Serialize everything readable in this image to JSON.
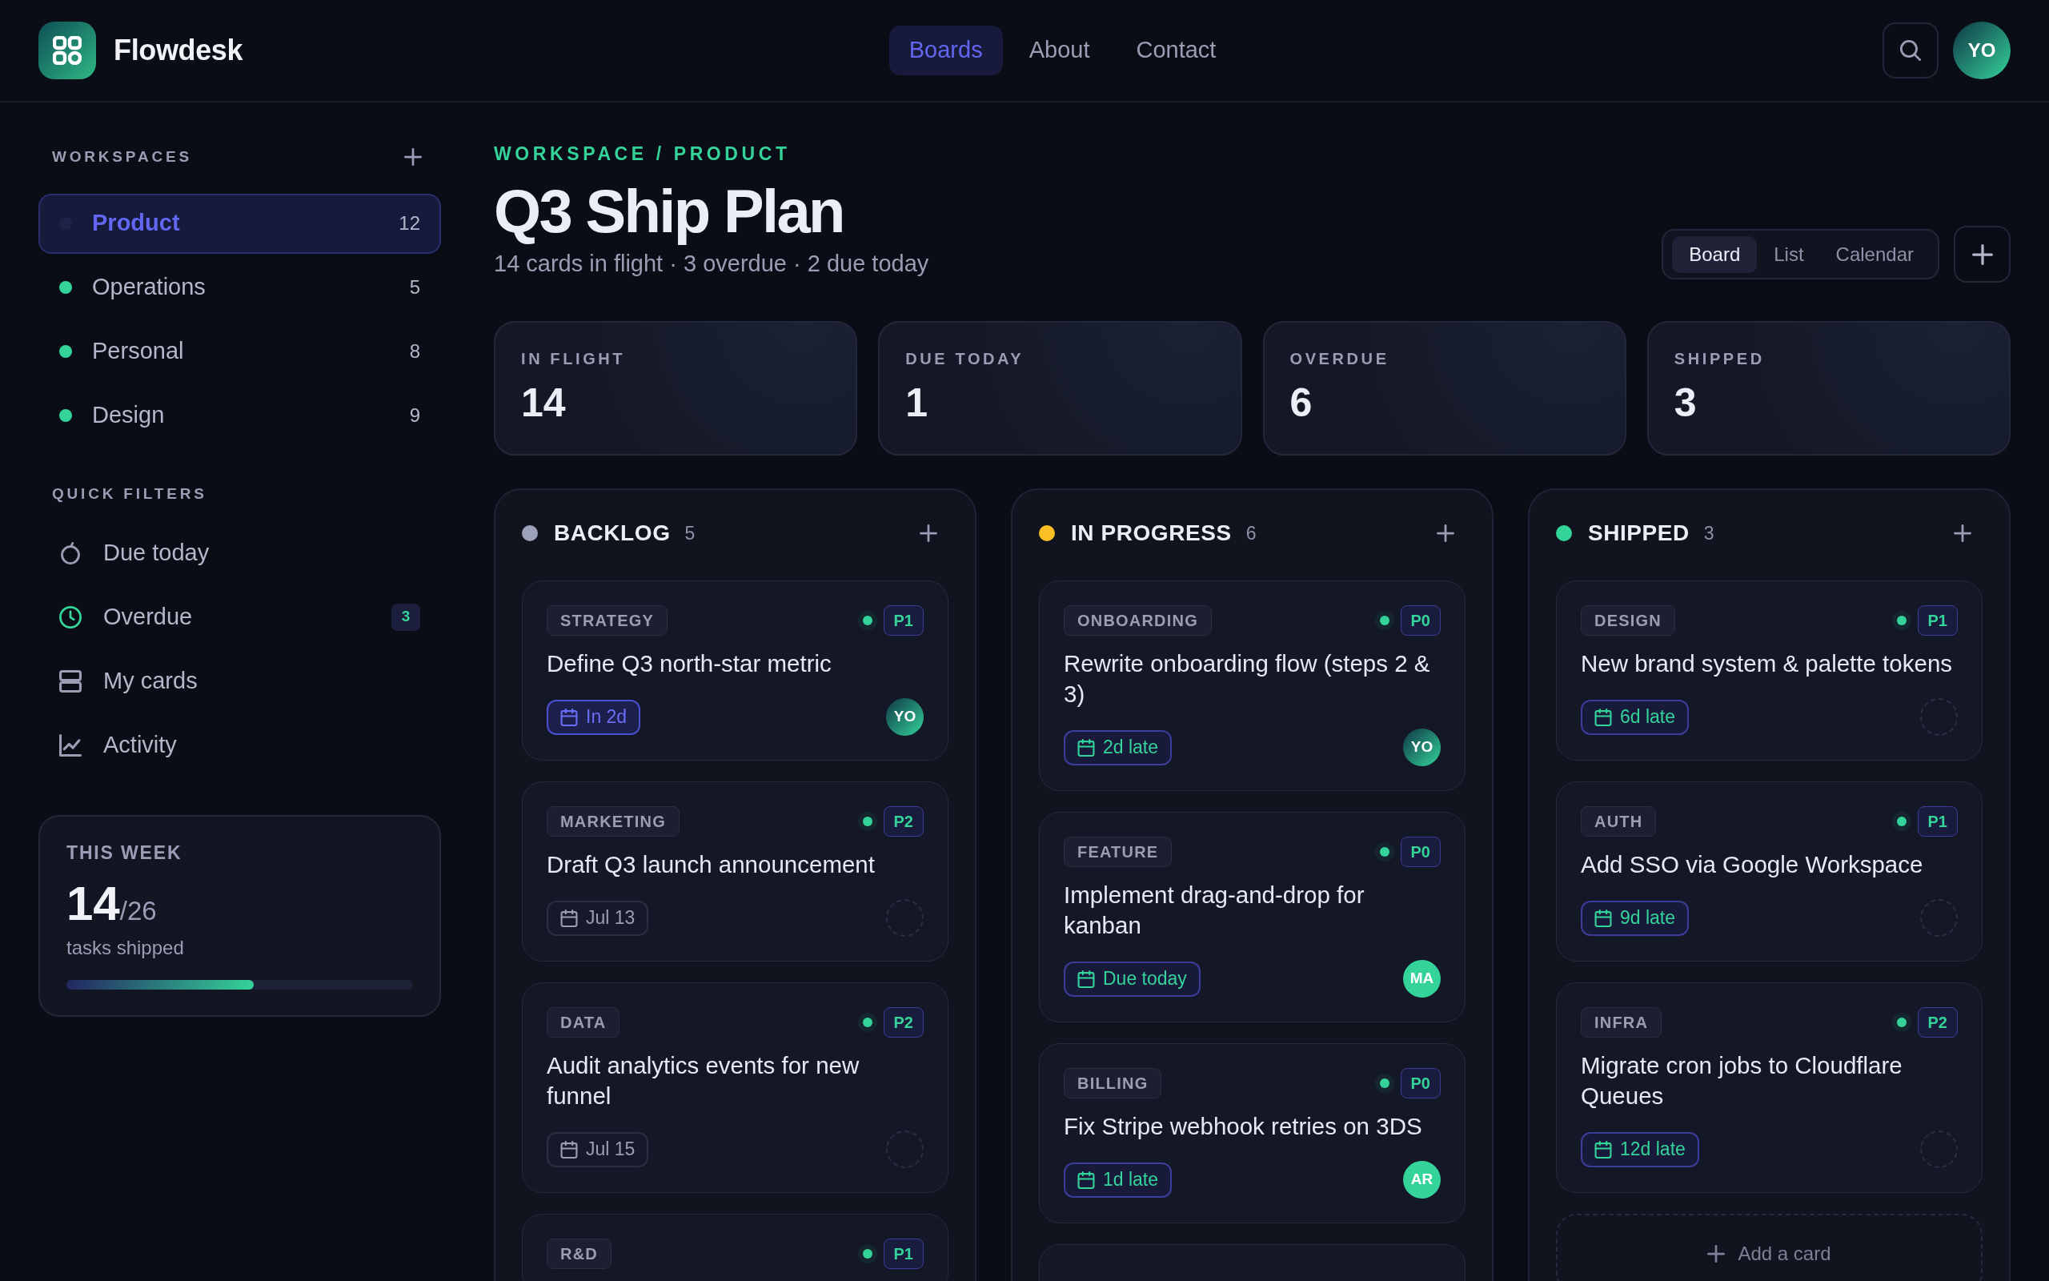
{
  "brand": {
    "name": "Flowdesk"
  },
  "nav": [
    {
      "label": "Boards",
      "selected": true
    },
    {
      "label": "About",
      "selected": false
    },
    {
      "label": "Contact",
      "selected": false
    }
  ],
  "user": {
    "initials": "YO"
  },
  "sidebar": {
    "workspaces_heading": "WORKSPACES",
    "workspaces": [
      {
        "name": "Product",
        "count": "12",
        "selected": true
      },
      {
        "name": "Operations",
        "count": "5",
        "selected": false
      },
      {
        "name": "Personal",
        "count": "8",
        "selected": false
      },
      {
        "name": "Design",
        "count": "9",
        "selected": false
      }
    ],
    "filters_heading": "QUICK FILTERS",
    "filters": [
      {
        "label": "Due today",
        "alert": false
      },
      {
        "label": "Overdue",
        "alert": true,
        "badge": "3"
      },
      {
        "label": "My cards",
        "alert": false
      },
      {
        "label": "Activity",
        "alert": false
      }
    ],
    "this_week": {
      "heading": "THIS WEEK",
      "done": "14",
      "total": "/26",
      "caption": "tasks shipped",
      "level": 0.54
    }
  },
  "breadcrumb": "WORKSPACE / PRODUCT",
  "title": "Q3 Ship Plan",
  "subtitle": "14 cards in flight · 3 overdue · 2 due today",
  "views": [
    {
      "label": "Board",
      "selected": true
    },
    {
      "label": "List",
      "selected": false
    },
    {
      "label": "Calendar",
      "selected": false
    }
  ],
  "stats": [
    {
      "label": "IN FLIGHT",
      "value": "14"
    },
    {
      "label": "DUE TODAY",
      "value": "1"
    },
    {
      "label": "OVERDUE",
      "value": "6"
    },
    {
      "label": "SHIPPED",
      "value": "3"
    }
  ],
  "columns": [
    {
      "name": "BACKLOG",
      "count": "5",
      "color": "#9ea2b8",
      "cards": [
        {
          "kind": "task",
          "tag": "STRATEGY",
          "priority": "P1",
          "title": "Define Q3 north-star metric",
          "due": {
            "label": "In 2d",
            "kind": "upcoming"
          },
          "assignee": {
            "kind": "gradient",
            "initials": "YO"
          }
        },
        {
          "kind": "task",
          "tag": "MARKETING",
          "priority": "P2",
          "title": "Draft Q3 launch announcement",
          "due": {
            "label": "Jul 13",
            "kind": "plain"
          },
          "assignee": {
            "kind": "unassigned"
          }
        },
        {
          "kind": "task",
          "tag": "DATA",
          "priority": "P2",
          "title": "Audit analytics events for new funnel",
          "due": {
            "label": "Jul 15",
            "kind": "plain"
          },
          "assignee": {
            "kind": "unassigned"
          }
        },
        {
          "kind": "task",
          "tag": "R&D",
          "priority": "P1"
        }
      ]
    },
    {
      "name": "IN PROGRESS",
      "count": "6",
      "color": "#fbbf24",
      "cards": [
        {
          "kind": "task",
          "tag": "ONBOARDING",
          "priority": "P0",
          "title": "Rewrite onboarding flow (steps 2 & 3)",
          "due": {
            "label": "2d late",
            "kind": "alert"
          },
          "assignee": {
            "kind": "gradient",
            "initials": "YO"
          }
        },
        {
          "kind": "task",
          "tag": "FEATURE",
          "priority": "P0",
          "title": "Implement drag-and-drop for kanban",
          "due": {
            "label": "Due today",
            "kind": "alert"
          },
          "assignee": {
            "kind": "solid",
            "initials": "MA"
          }
        },
        {
          "kind": "task",
          "tag": "BILLING",
          "priority": "P0",
          "title": "Fix Stripe webhook retries on 3DS",
          "due": {
            "label": "1d late",
            "kind": "alert"
          },
          "assignee": {
            "kind": "solid",
            "initials": "AR"
          }
        },
        {
          "kind": "stub"
        }
      ]
    },
    {
      "name": "SHIPPED",
      "count": "3",
      "color": "#34d399",
      "cards": [
        {
          "kind": "task",
          "tag": "DESIGN",
          "priority": "P1",
          "title": "New brand system & palette tokens",
          "due": {
            "label": "6d late",
            "kind": "alert"
          },
          "assignee": {
            "kind": "unassigned"
          }
        },
        {
          "kind": "task",
          "tag": "AUTH",
          "priority": "P1",
          "title": "Add SSO via Google Workspace",
          "due": {
            "label": "9d late",
            "kind": "alert"
          },
          "assignee": {
            "kind": "unassigned"
          }
        },
        {
          "kind": "task",
          "tag": "INFRA",
          "priority": "P2",
          "title": "Migrate cron jobs to Cloudflare Queues",
          "due": {
            "label": "12d late",
            "kind": "alert"
          },
          "assignee": {
            "kind": "unassigned"
          }
        }
      ],
      "add_button": "Add a card"
    }
  ]
}
